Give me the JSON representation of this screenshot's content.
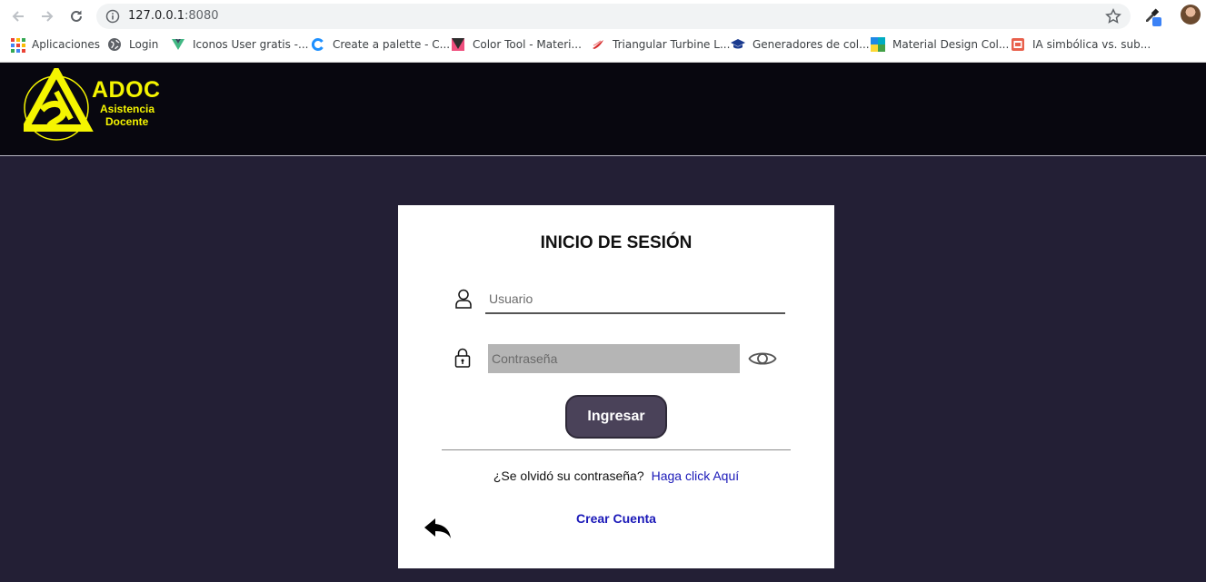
{
  "browser": {
    "url_host": "127.0.0.1",
    "url_port": ":8080",
    "bookmarks": [
      {
        "label": "Aplicaciones",
        "icon": "apps-grid-icon"
      },
      {
        "label": "Login",
        "icon": "globe-icon"
      },
      {
        "label": "Iconos User gratis -...",
        "icon": "vue-icon"
      },
      {
        "label": "Create a palette - C...",
        "icon": "c-logo-icon"
      },
      {
        "label": "Color Tool - Materi...",
        "icon": "color-tool-icon"
      },
      {
        "label": "Triangular Turbine L...",
        "icon": "turbine-icon"
      },
      {
        "label": "Generadores de col...",
        "icon": "graduation-cap-icon"
      },
      {
        "label": "Material Design Col...",
        "icon": "material-palette-icon"
      },
      {
        "label": "IA simbólica vs. sub...",
        "icon": "slides-icon"
      }
    ]
  },
  "header": {
    "logo_title": "ADOC",
    "logo_sub1": "Asistencia",
    "logo_sub2": "Docente",
    "brand_color": "#f5f500"
  },
  "login": {
    "title": "INICIO DE SESIÓN",
    "username_placeholder": "Usuario",
    "password_placeholder": "Contraseña",
    "submit_label": "Ingresar",
    "forgot_text": "¿Se olvidó su contraseña?",
    "forgot_link": "Haga click Aquí",
    "create_account": "Crear Cuenta"
  }
}
